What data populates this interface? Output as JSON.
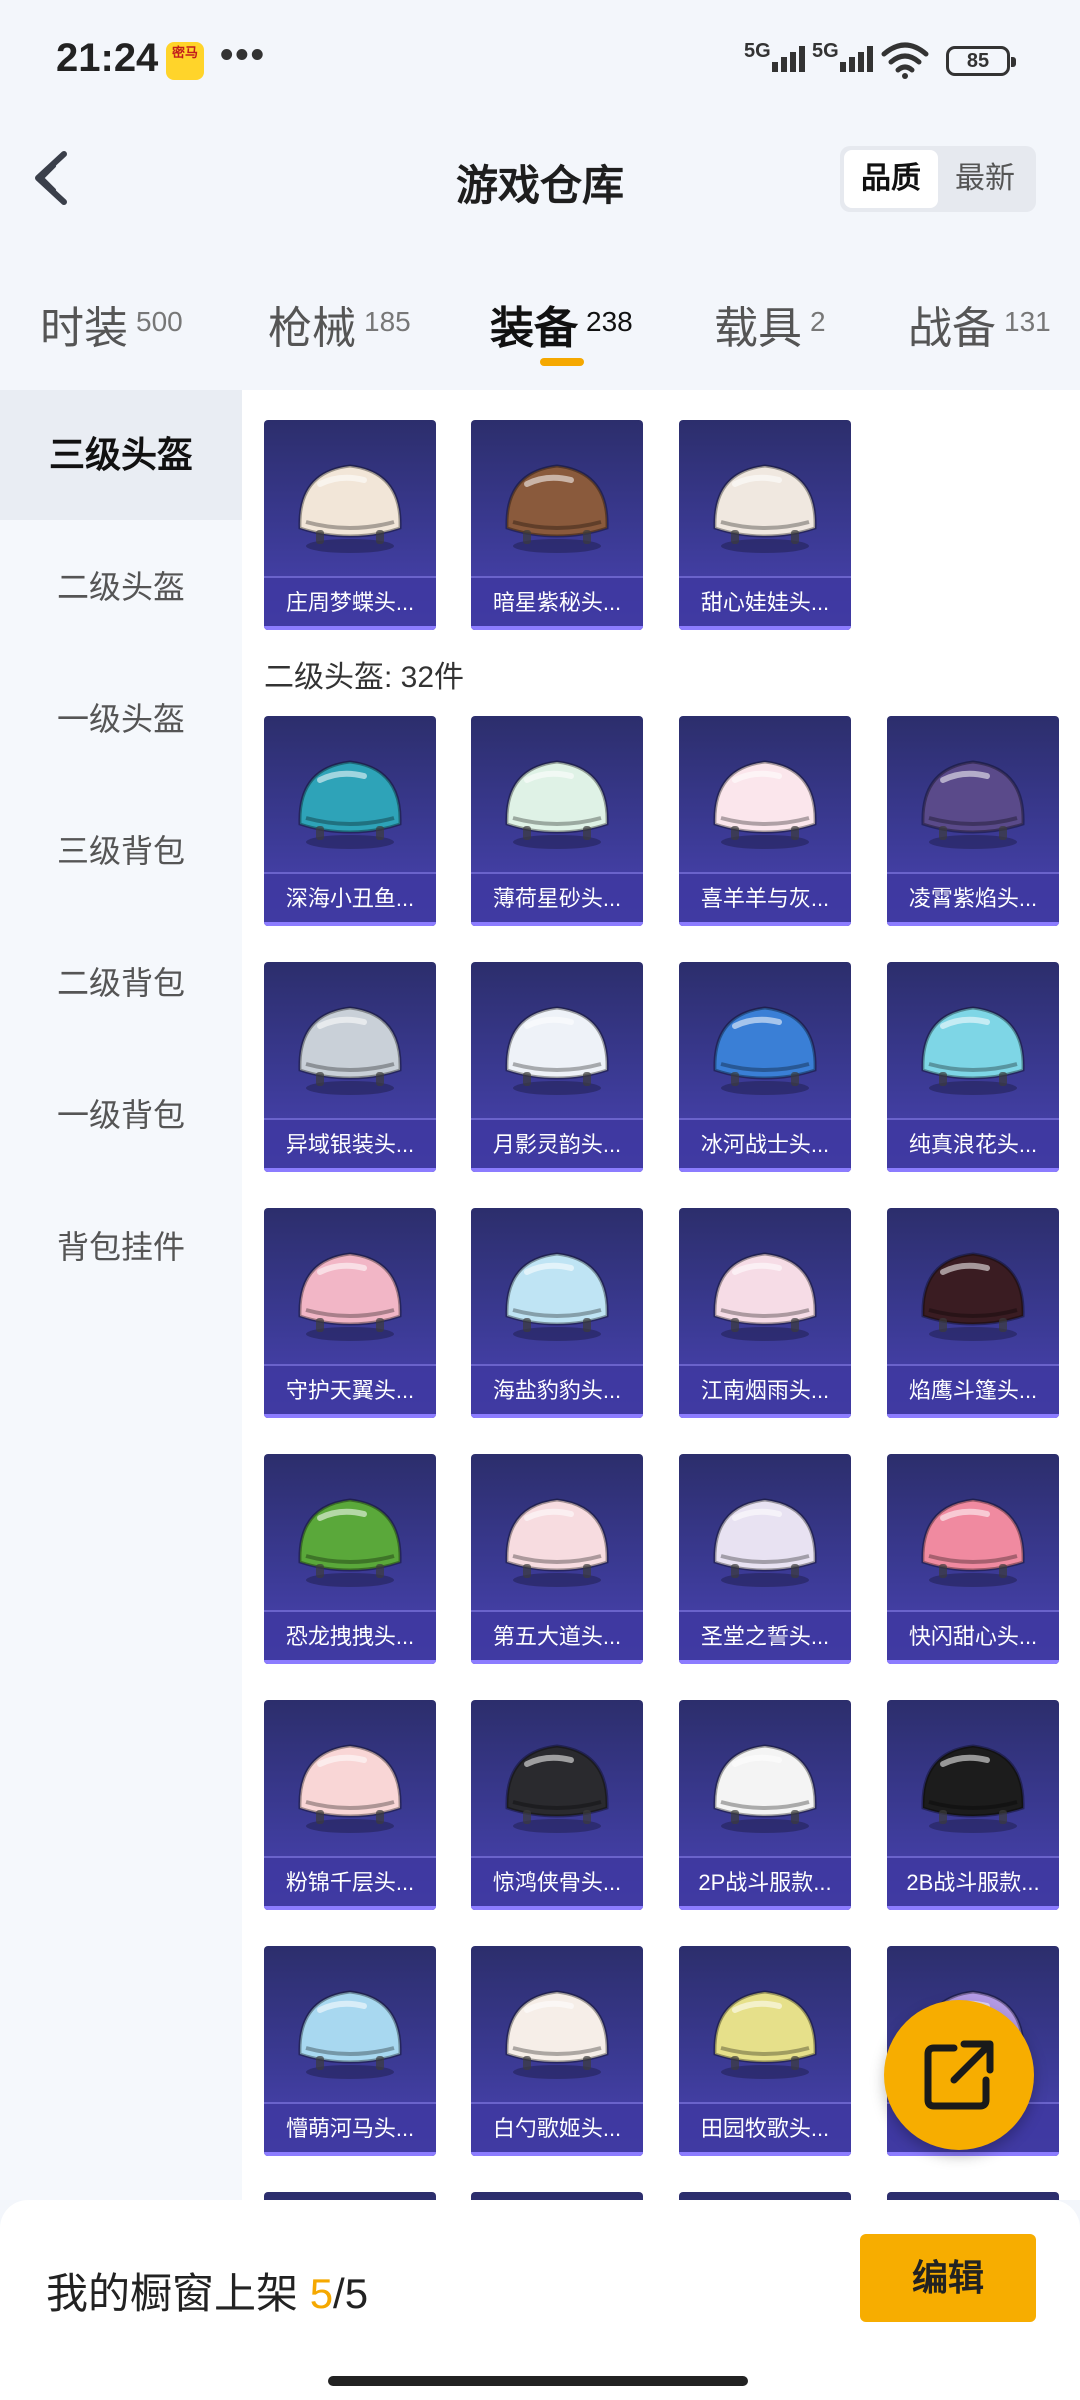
{
  "status": {
    "time": "21:24",
    "app_badge": "密马",
    "more": "•••",
    "net1": "5G",
    "net2": "5G",
    "battery": "85"
  },
  "header": {
    "title": "游戏仓库",
    "sort": {
      "quality": "品质",
      "latest": "最新"
    }
  },
  "tabs": [
    {
      "label": "时装",
      "count": "500"
    },
    {
      "label": "枪械",
      "count": "185"
    },
    {
      "label": "装备",
      "count": "238"
    },
    {
      "label": "载具",
      "count": "2"
    },
    {
      "label": "战备",
      "count": "131"
    }
  ],
  "sidebar": [
    {
      "label": "三级头盔"
    },
    {
      "label": "二级头盔"
    },
    {
      "label": "一级头盔"
    },
    {
      "label": "三级背包"
    },
    {
      "label": "二级背包"
    },
    {
      "label": "一级背包"
    },
    {
      "label": "背包挂件"
    }
  ],
  "level3_items": [
    {
      "name": "庄周梦蝶头..."
    },
    {
      "name": "暗星紫秘头..."
    },
    {
      "name": "甜心娃娃头..."
    }
  ],
  "level2_section": {
    "title": "二级头盔: 32件"
  },
  "level2_items": [
    {
      "name": "深海小丑鱼..."
    },
    {
      "name": "薄荷星砂头..."
    },
    {
      "name": "喜羊羊与灰..."
    },
    {
      "name": "凌霄紫焰头..."
    },
    {
      "name": "异域银装头..."
    },
    {
      "name": "月影灵韵头..."
    },
    {
      "name": "冰河战士头..."
    },
    {
      "name": "纯真浪花头..."
    },
    {
      "name": "守护天翼头..."
    },
    {
      "name": "海盐豹豹头..."
    },
    {
      "name": "江南烟雨头..."
    },
    {
      "name": "焰鹰斗篷头..."
    },
    {
      "name": "恐龙拽拽头..."
    },
    {
      "name": "第五大道头..."
    },
    {
      "name": "圣堂之誓头..."
    },
    {
      "name": "快闪甜心头..."
    },
    {
      "name": "粉锦千层头..."
    },
    {
      "name": "惊鸿侠骨头..."
    },
    {
      "name": "2P战斗服款..."
    },
    {
      "name": "2B战斗服款..."
    },
    {
      "name": "懵萌河马头..."
    },
    {
      "name": "白勺歌姬头..."
    },
    {
      "name": "田园牧歌头..."
    },
    {
      "name": "..."
    }
  ],
  "helmet_colors": [
    "#f2e6d8",
    "#8a5a3c",
    "#f0e8e0",
    "#2ea3b8",
    "#dff2e6",
    "#fbe6ec",
    "#5a4a8a",
    "#c9d0d8",
    "#eef2f8",
    "#3a7fd6",
    "#7ed6e6",
    "#f2b6c6",
    "#bfe4f4",
    "#f6dce6",
    "#3a1c22",
    "#5aa83a",
    "#f7dce0",
    "#e8e2f2",
    "#f08aa0",
    "#f9d6d6",
    "#2a2a2e",
    "#f4f4f4",
    "#1c1c1c",
    "#a8d8f0",
    "#f6eee8",
    "#e6e08a",
    "#b49be6"
  ],
  "footer": {
    "showcase_label": "我的橱窗上架",
    "count_current": "5",
    "count_total": "/5",
    "edit": "编辑"
  }
}
